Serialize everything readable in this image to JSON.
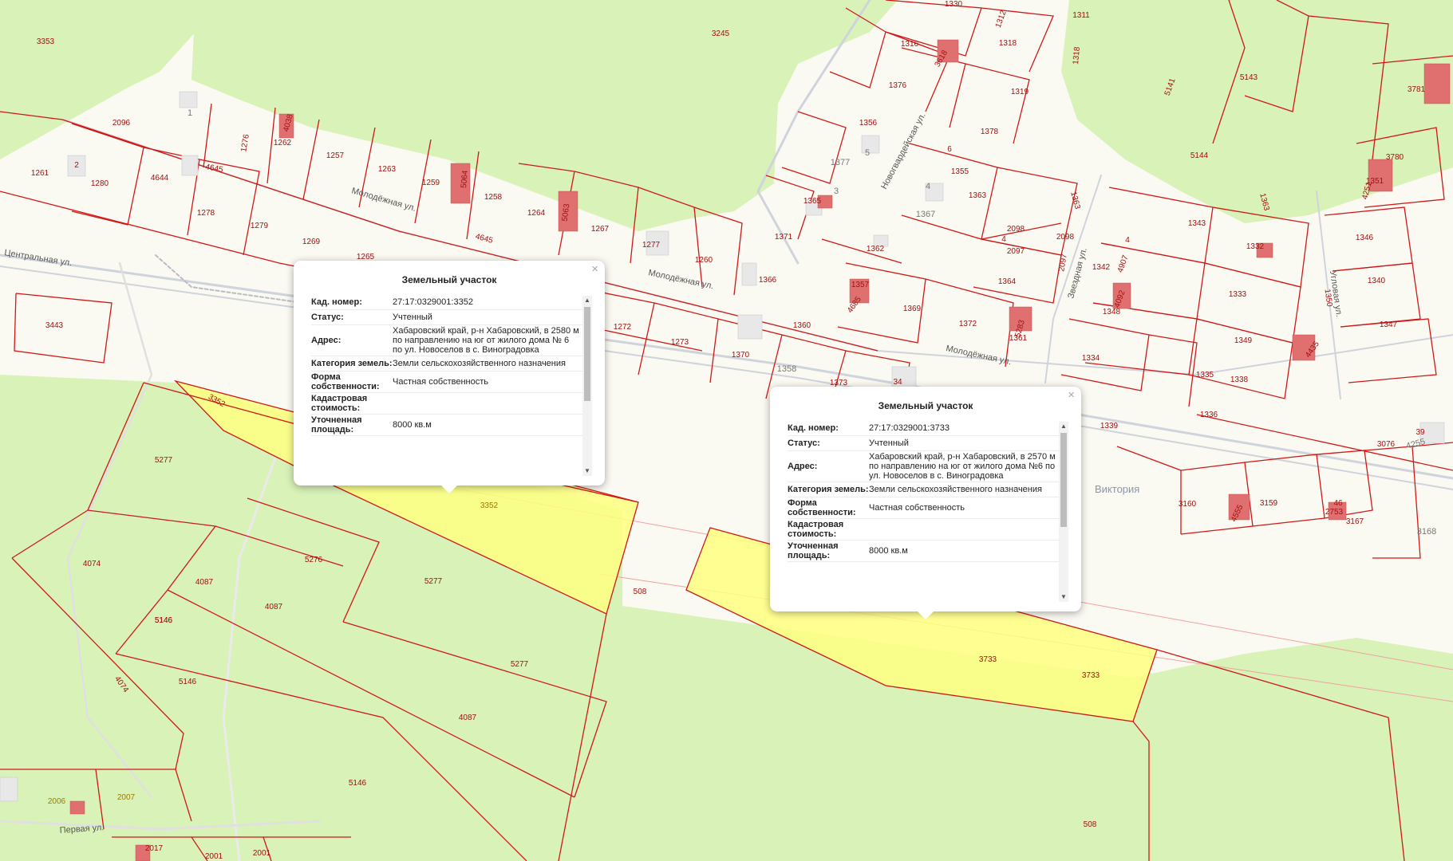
{
  "parcels": [
    "3353",
    "3245",
    "1330",
    "1311",
    "1316",
    "3618",
    "1318",
    "5143",
    "3781",
    "1376",
    "1319",
    "2096",
    "1",
    "1276",
    "1262",
    "4038",
    "1257",
    "1263",
    "1356",
    "1378",
    "1259",
    "5064",
    "1258",
    "1264",
    "5063",
    "1267",
    "1377",
    "5",
    "6",
    "1355",
    "1261",
    "2",
    "1280",
    "4644",
    "4645",
    "1278",
    "1279",
    "1269",
    "1265",
    "1365",
    "3",
    "1363",
    "1363",
    "1343",
    "1332",
    "1346",
    "1342",
    "4907",
    "1371",
    "2098",
    "2098",
    "2097",
    "4645",
    "1277",
    "1260",
    "1366",
    "1362",
    "1367",
    "4",
    "4",
    "1364",
    "1333",
    "1340",
    "3443",
    "1357",
    "4685",
    "1369",
    "1372",
    "5283",
    "1361",
    "1360",
    "1348",
    "4092",
    "1349",
    "4435",
    "1347",
    "1272",
    "1273",
    "1370",
    "1358",
    "1373",
    "34",
    "1334",
    "1335",
    "1338",
    "1351",
    "4251",
    "3780",
    "5144",
    "1336",
    "1339",
    "3076",
    "4255",
    "39",
    "5277",
    "3160",
    "4555",
    "3159",
    "2753",
    "46",
    "3167",
    "3168",
    "3352",
    "3352",
    "5276",
    "4087",
    "5277",
    "4074",
    "508",
    "5146",
    "5146",
    "4087",
    "5277",
    "3733",
    "3733",
    "4074",
    "5146",
    "4087",
    "2006",
    "2007",
    "5146",
    "2017",
    "2001",
    "2001",
    "508",
    "1312",
    "1318",
    "5141",
    "1363",
    "1350",
    "2097",
    "4"
  ],
  "streets": {
    "central": "Центральная ул.",
    "molodezhnaya": "Молодёжная ул.",
    "novogvardeiskaya": "Новогвардейская ул.",
    "zvezdnaya": "Звездная ул.",
    "uglovaya": "Угловая ул.",
    "pervaya": "Первая ул."
  },
  "place_label": "Виктория",
  "popups": [
    {
      "title": "Земельный участок",
      "close": "×",
      "rows": [
        {
          "key": "Кад. номер:",
          "value": "27:17:0329001:3352"
        },
        {
          "key": "Статус:",
          "value": "Учтенный"
        },
        {
          "key": "Адрес:",
          "value": "Хабаровский край, р-н Хабаровский, в 2580 м по направлению на юг от жилого дома № 6 по ул. Новоселов в с. Виноградовка"
        },
        {
          "key": "Категория земель:",
          "value": "Земли сельскохозяйственного назначения"
        },
        {
          "key": "Форма собственности:",
          "value": "Частная собственность"
        },
        {
          "key": "Кадастровая стоимость:",
          "value": ""
        },
        {
          "key": "Уточненная площадь:",
          "value": "8000 кв.м"
        }
      ]
    },
    {
      "title": "Земельный участок",
      "close": "×",
      "rows": [
        {
          "key": "Кад. номер:",
          "value": "27:17:0329001:3733"
        },
        {
          "key": "Статус:",
          "value": "Учтенный"
        },
        {
          "key": "Адрес:",
          "value": "Хабаровский край, р-н Хабаровский, в 2570 м по направлению на юг от жилого дома №6 по ул. Новоселов в с. Виноградовка"
        },
        {
          "key": "Категория земель:",
          "value": "Земли сельскохозяйственного назначения"
        },
        {
          "key": "Форма собственности:",
          "value": "Частная собственность"
        },
        {
          "key": "Кадастровая стоимость:",
          "value": ""
        },
        {
          "key": "Уточненная площадь:",
          "value": "8000 кв.м"
        }
      ]
    }
  ],
  "colors": {
    "parcel_border": "#d01818",
    "agri_fill": "#d8f2b8",
    "selected_fill": "#ffff80",
    "building": "#e07070"
  }
}
